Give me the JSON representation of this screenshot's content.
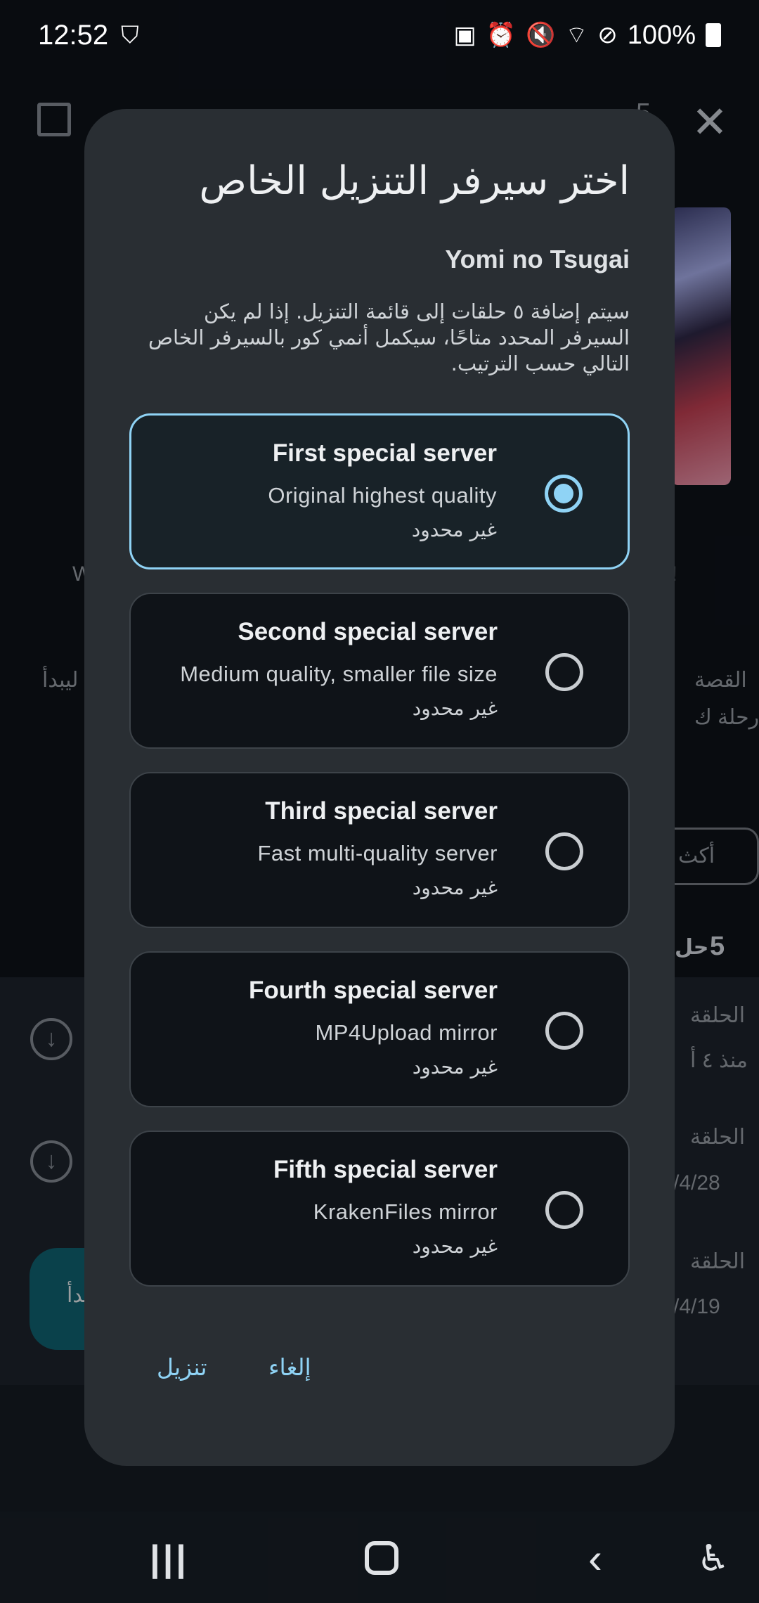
{
  "status_bar": {
    "time": "12:52",
    "shield_icon": "shield-check-icon",
    "battery": "100%"
  },
  "background": {
    "count_label": "5",
    "episode_label": "الحلقة",
    "ago_label": "منذ ٤ أ",
    "date1": "/4/28",
    "date2": "/4/19",
    "story_label": "القصة",
    "story_label2": "رحلة ك",
    "starts_label": "ليبدأ",
    "more_label": "أكث",
    "fab_label": "بدأ",
    "w_label": "W",
    "excl": "!",
    "count_suffix": "حل"
  },
  "dialog": {
    "title": "اختر سيرفر التنزيل الخاص",
    "anime_name": "Yomi no Tsugai",
    "description": "سيتم إضافة ٥ حلقات إلى قائمة التنزيل. إذا لم يكن السيرفر المحدد متاحًا، سيكمل أنمي كور بالسيرفر الخاص التالي حسب الترتيب.",
    "servers": [
      {
        "name": "First special server",
        "subtitle": "Original highest quality",
        "limit": "غير محدود",
        "selected": true
      },
      {
        "name": "Second special server",
        "subtitle": "Medium quality, smaller file size",
        "limit": "غير محدود",
        "selected": false
      },
      {
        "name": "Third special server",
        "subtitle": "Fast multi-quality server",
        "limit": "غير محدود",
        "selected": false
      },
      {
        "name": "Fourth special server",
        "subtitle": "MP4Upload mirror",
        "limit": "غير محدود",
        "selected": false
      },
      {
        "name": "Fifth special server",
        "subtitle": "KrakenFiles mirror",
        "limit": "غير محدود",
        "selected": false
      }
    ],
    "cancel_label": "إلغاء",
    "download_label": "تنزيل"
  },
  "colors": {
    "accent": "#8fd3f5",
    "dialog_bg": "#292e33",
    "card_bg": "#0f1318"
  }
}
